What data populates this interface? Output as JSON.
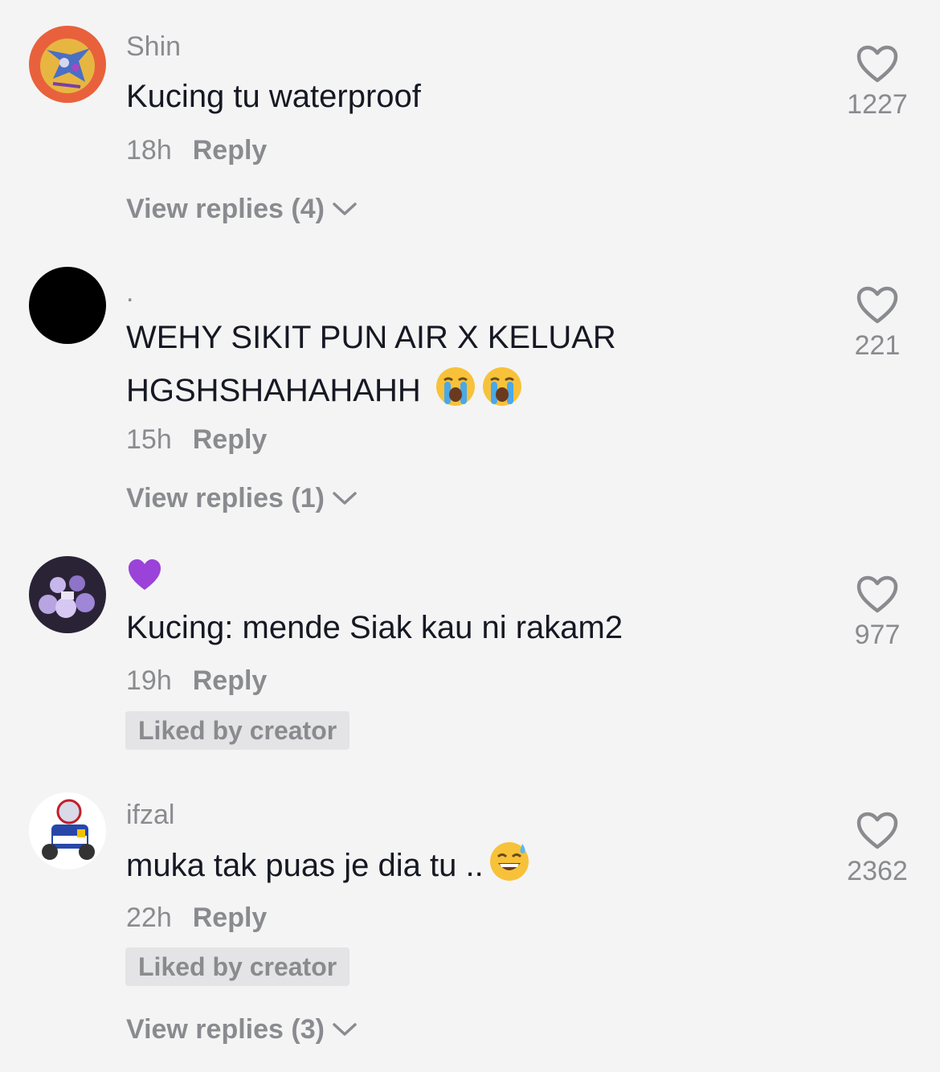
{
  "comments": [
    {
      "username": "Shin",
      "text": "Kucing tu waterproof",
      "time": "18h",
      "reply_label": "Reply",
      "view_replies": "View replies (4)",
      "likes": "1227"
    },
    {
      "username": ".",
      "text": "WEHY SIKIT PUN AIR X KELUAR HGSHSHAHAHAHH",
      "emoji": "loudly-crying-face",
      "time": "15h",
      "reply_label": "Reply",
      "view_replies": "View replies (1)",
      "likes": "221"
    },
    {
      "username_emoji": "purple-heart",
      "text": "Kucing: mende Siak kau ni rakam2",
      "time": "19h",
      "reply_label": "Reply",
      "badge": "Liked by creator",
      "likes": "977"
    },
    {
      "username": "ifzal",
      "text": "muka tak puas je dia tu ..",
      "emoji": "grinning-face-with-sweat",
      "time": "22h",
      "reply_label": "Reply",
      "badge": "Liked by creator",
      "view_replies": "View replies (3)",
      "likes": "2362"
    }
  ],
  "colors": {
    "background": "#f4f4f4",
    "text_primary": "#161823",
    "text_secondary": "#8a8b8f",
    "badge_bg": "#e4e4e6"
  }
}
